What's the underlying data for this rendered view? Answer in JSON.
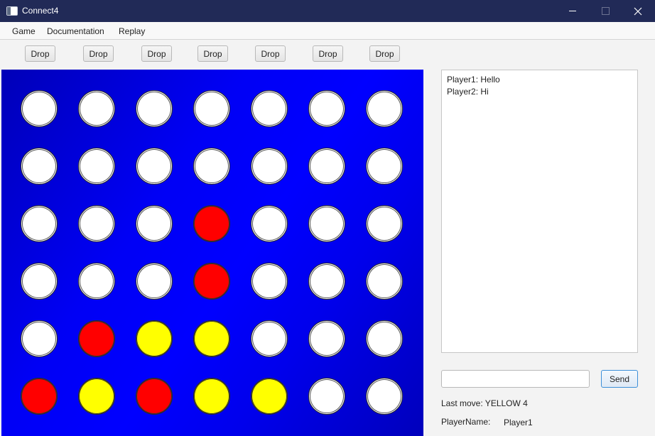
{
  "window": {
    "title": "Connect4",
    "icon": "app-window-icon"
  },
  "menu": [
    "Game",
    "Documentation",
    "Replay"
  ],
  "drop_label": "Drop",
  "board": {
    "colors": {
      "red": "#ff0000",
      "yellow": "#ffff00",
      "white": "#ffffff",
      "board": "#0000ff"
    },
    "grid": [
      [
        "W",
        "W",
        "W",
        "W",
        "W",
        "W",
        "W"
      ],
      [
        "W",
        "W",
        "W",
        "W",
        "W",
        "W",
        "W"
      ],
      [
        "W",
        "W",
        "W",
        "R",
        "W",
        "W",
        "W"
      ],
      [
        "W",
        "W",
        "W",
        "R",
        "W",
        "W",
        "W"
      ],
      [
        "W",
        "R",
        "Y",
        "Y",
        "W",
        "W",
        "W"
      ],
      [
        "R",
        "Y",
        "R",
        "Y",
        "Y",
        "W",
        "W"
      ]
    ]
  },
  "chat": {
    "messages": [
      "Player1: Hello",
      "Player2: Hi"
    ],
    "input_value": "",
    "send_label": "Send"
  },
  "status": {
    "last_move": "Last move: YELLOW 4",
    "player_name_label": "PlayerName:",
    "player_name": "Player1"
  }
}
